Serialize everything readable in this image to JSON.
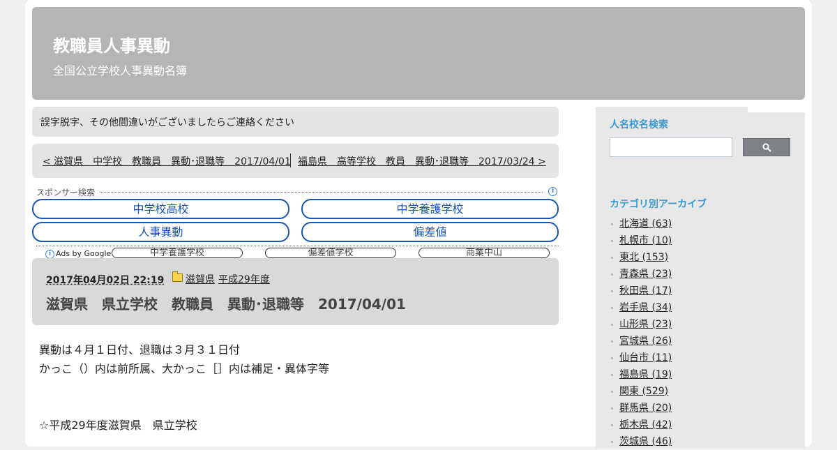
{
  "site": {
    "title": "教職員人事異動",
    "description": "全国公立学校人事異動名簿"
  },
  "notice": "誤字脱字、その他間違いがございましたらご連絡ください",
  "post_nav": {
    "prev": "< 滋賀県　中学校　教職員　異動･退職等　2017/04/01",
    "next": "福島県　高等学校　教員　異動･退職等　2017/03/24 >"
  },
  "ads": {
    "label": "スポンサー検索",
    "buttons": [
      "中学校高校",
      "中学養護学校",
      "人事異動",
      "偏差値"
    ],
    "ads_by": "Ads by Google",
    "small_links": [
      "中学養護学校",
      "偏差値学校",
      "商業中山"
    ]
  },
  "post": {
    "date": "2017年04月02日 22:19",
    "categories": [
      "滋賀県",
      "平成29年度"
    ],
    "title": "滋賀県　県立学校　教職員　異動･退職等　2017/04/01",
    "body": [
      "異動は４月１日付、退職は３月３１日付",
      "かっこ（）内は前所属、大かっこ［］内は補足・異体字等",
      "☆平成29年度滋賀県　県立学校"
    ]
  },
  "sidebar": {
    "search_title": "人名校名検索",
    "archive_title": "カテゴリ別アーカイブ",
    "categories": [
      "北海道 (63)",
      "札幌市 (10)",
      "東北 (153)",
      "青森県 (23)",
      "秋田県 (17)",
      "岩手県 (34)",
      "山形県 (23)",
      "宮城県 (26)",
      "仙台市 (11)",
      "福島県 (19)",
      "関東 (529)",
      "群馬県 (20)",
      "栃木県 (42)",
      "茨城県 (46)"
    ]
  }
}
